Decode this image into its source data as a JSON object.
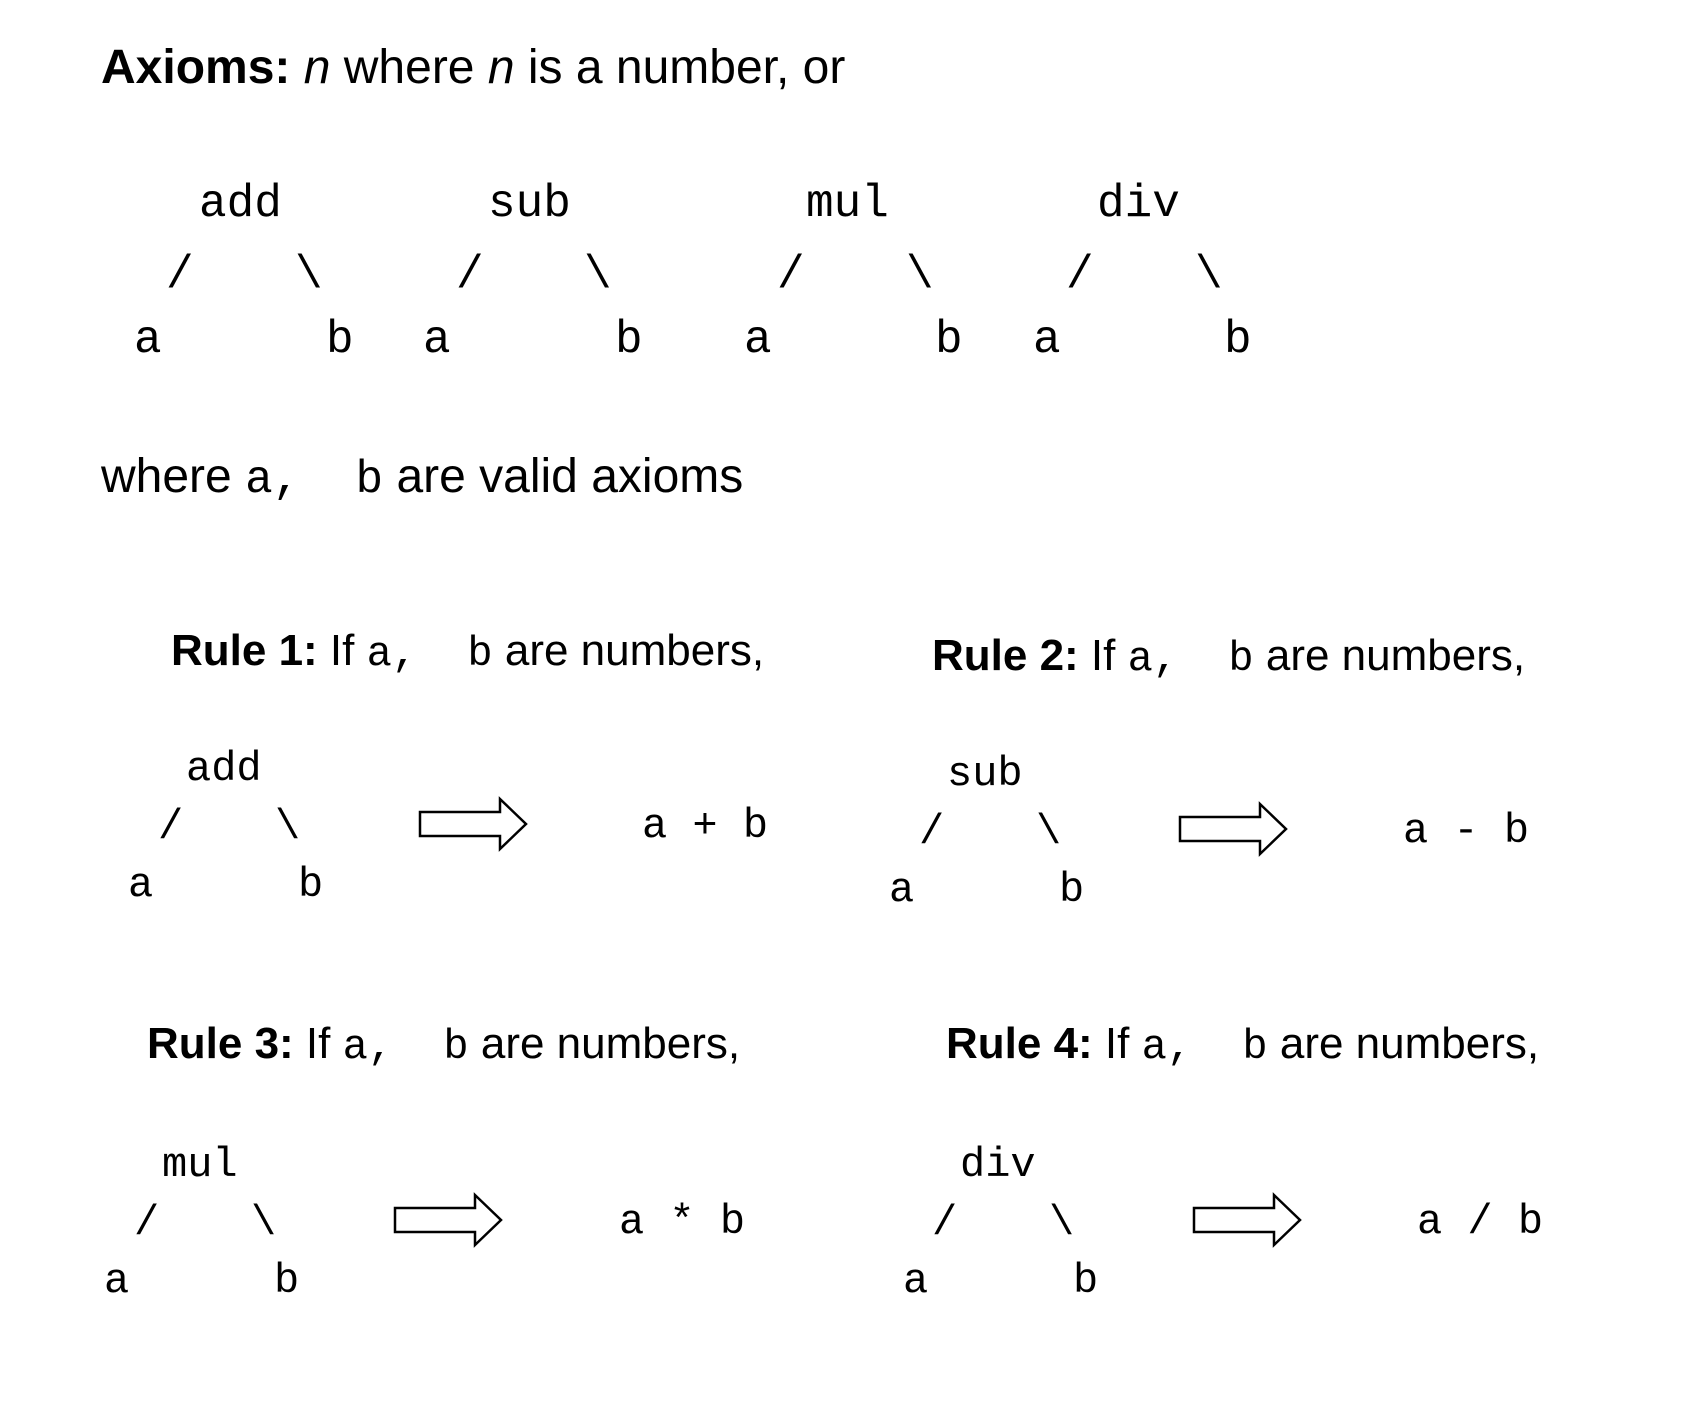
{
  "header": {
    "axioms_label": "Axioms:",
    "n_var_1": "n",
    "mid_text": " where ",
    "n_var_2": "n",
    "end_text": " is a number, or"
  },
  "axiom_trees": [
    {
      "op": "add",
      "left_slash": "/",
      "right_slash": "\\",
      "left": "a",
      "right": "b"
    },
    {
      "op": "sub",
      "left_slash": "/",
      "right_slash": "\\",
      "left": "a",
      "right": "b"
    },
    {
      "op": "mul",
      "left_slash": "/",
      "right_slash": "\\",
      "left": "a",
      "right": "b"
    },
    {
      "op": "div",
      "left_slash": "/",
      "right_slash": "\\",
      "left": "a",
      "right": "b"
    }
  ],
  "where_line": {
    "prefix": "where ",
    "vars": "a,  b",
    "suffix": " are valid axioms"
  },
  "rules": [
    {
      "label": "Rule 1:",
      "if_text": " If ",
      "vars": "a,  b",
      "rest": " are numbers,",
      "op": "add",
      "left_slash": "/",
      "right_slash": "\\",
      "left": "a",
      "right": "b",
      "result": "a + b"
    },
    {
      "label": "Rule 2:",
      "if_text": " If ",
      "vars": "a,  b",
      "rest": " are numbers,",
      "op": "sub",
      "left_slash": "/",
      "right_slash": "\\",
      "left": "a",
      "right": "b",
      "result": "a - b"
    },
    {
      "label": "Rule 3:",
      "if_text": " If ",
      "vars": "a,  b",
      "rest": " are numbers,",
      "op": "mul",
      "left_slash": "/",
      "right_slash": "\\",
      "left": "a",
      "right": "b",
      "result": "a * b"
    },
    {
      "label": "Rule 4:",
      "if_text": " If ",
      "vars": "a,  b",
      "rest": " are numbers,",
      "op": "div",
      "left_slash": "/",
      "right_slash": "\\",
      "left": "a",
      "right": "b",
      "result": "a / b"
    }
  ]
}
